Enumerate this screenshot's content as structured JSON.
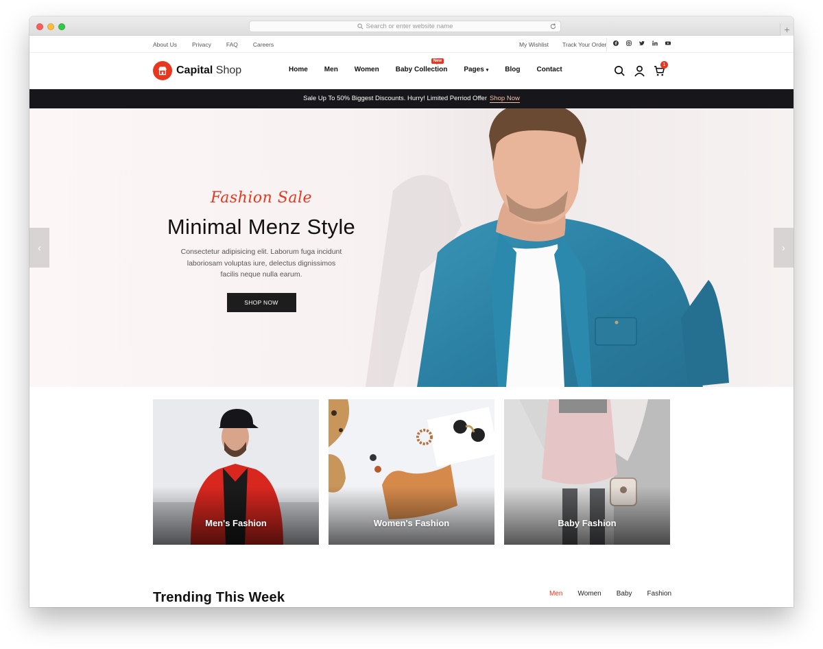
{
  "browser": {
    "url_placeholder": "Search or enter website name",
    "new_tab_symbol": "+"
  },
  "topbar": {
    "left_links": [
      "About Us",
      "Privacy",
      "FAQ",
      "Careers"
    ],
    "wishlist": "My Wishlist",
    "track_order": "Track Your Order",
    "social_icons": [
      "facebook-icon",
      "instagram-icon",
      "twitter-icon",
      "linkedin-icon",
      "youtube-icon"
    ]
  },
  "header": {
    "logo_bold": "Capital",
    "logo_light": "Shop",
    "nav": [
      "Home",
      "Men",
      "Women",
      "Baby Collection",
      "Pages",
      "Blog",
      "Contact"
    ],
    "new_badge": "New",
    "cart_count": "1",
    "accent_color": "#e8371f"
  },
  "promo": {
    "text": "Sale Up To 50% Biggest Discounts. Hurry! Limited Perriod Offer",
    "link": "Shop Now"
  },
  "hero": {
    "script_text": "Fashion Sale",
    "title": "Minimal Menz Style",
    "description": "Consectetur adipisicing elit. Laborum fuga incidunt laboriosam voluptas iure, delectus dignissimos facilis neque nulla earum.",
    "button": "SHOP NOW",
    "prev_arrow": "‹",
    "next_arrow": "›"
  },
  "categories": [
    {
      "label": "Men's Fashion"
    },
    {
      "label": "Women's Fashion"
    },
    {
      "label": "Baby Fashion"
    }
  ],
  "trending": {
    "title": "Trending This Week",
    "tabs": [
      "Men",
      "Women",
      "Baby",
      "Fashion"
    ],
    "active_tab": "Men"
  }
}
